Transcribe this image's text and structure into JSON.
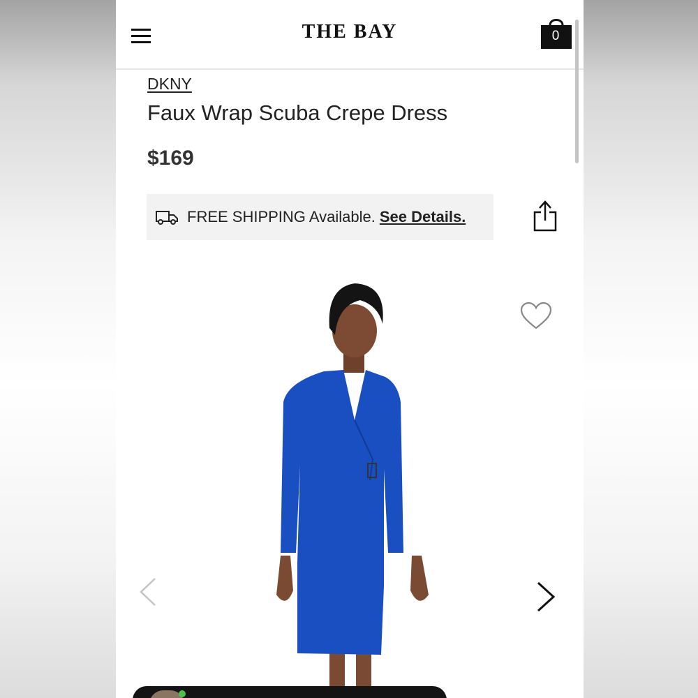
{
  "header": {
    "logo": "THE BAY",
    "bag_count": "0"
  },
  "product": {
    "brand": "DKNY",
    "name": "Faux Wrap Scuba Crepe Dress",
    "price": "$169",
    "dress_color": "#1a4fc2"
  },
  "shipping": {
    "text": "FREE SHIPPING Available.",
    "link": "See Details."
  },
  "icons": {
    "menu": "hamburger-menu-icon",
    "bag": "shopping-bag-icon",
    "truck": "delivery-truck-icon",
    "share": "share-icon",
    "favorite": "heart-icon",
    "prev": "chevron-left-icon",
    "next": "chevron-right-icon"
  }
}
